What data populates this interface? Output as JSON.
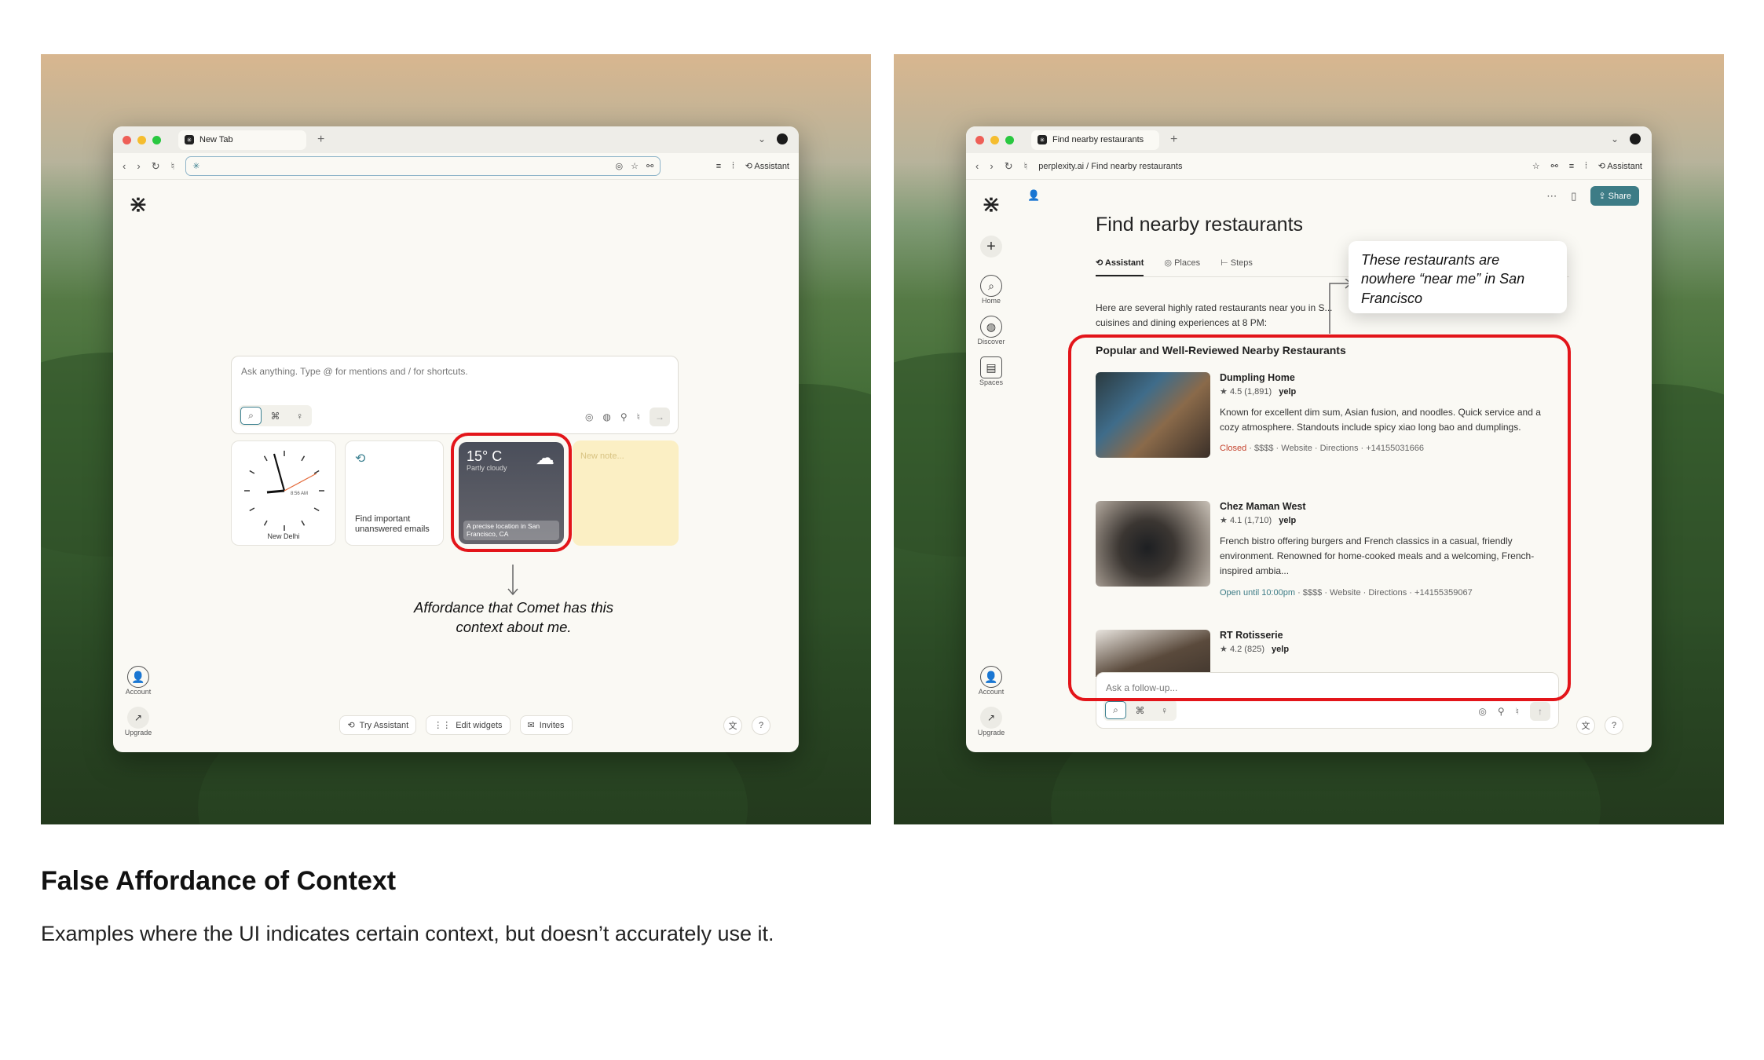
{
  "left": {
    "tab_title": "New Tab",
    "assistant_label": "Assistant",
    "ask_placeholder": "Ask anything. Type @ for mentions and / for shortcuts.",
    "clock_time": "8:56 AM",
    "clock_city": "New Delhi",
    "email_widget": "Find important unanswered emails",
    "weather_temp": "15° C",
    "weather_condition": "Partly cloudy",
    "weather_location": "A precise location in San Francisco, CA",
    "note_placeholder": "New note...",
    "account_label": "Account",
    "upgrade_label": "Upgrade",
    "chips": [
      "Try Assistant",
      "Edit widgets",
      "Invites"
    ],
    "annotation": "Affordance that Comet has this context about me."
  },
  "right": {
    "tab_title": "Find nearby restaurants",
    "url": "perplexity.ai / Find nearby restaurants",
    "assistant_label": "Assistant",
    "share_label": "Share",
    "page_title": "Find nearby restaurants",
    "tabs": [
      "Assistant",
      "Places",
      "Steps"
    ],
    "intro": "Here are several highly rated restaurants near you in S... cuisines and dining experiences at 8 PM:",
    "section_title": "Popular and Well-Reviewed Nearby Restaurants",
    "nav": [
      "Home",
      "Discover",
      "Spaces"
    ],
    "account_label": "Account",
    "upgrade_label": "Upgrade",
    "callout": "These restaurants are nowhere “near me” in San Francisco",
    "followup_placeholder": "Ask a follow-up...",
    "restaurants": [
      {
        "name": "Dumpling Home",
        "rating": "4.5",
        "reviews": "(1,891)",
        "source": "yelp",
        "desc": "Known for excellent dim sum, Asian fusion, and noodles. Quick service and a cozy atmosphere. Standouts include spicy xiao long bao and dumplings.",
        "status": "Closed",
        "meta": " · $$$$ · Website · Directions · +14155031666"
      },
      {
        "name": "Chez Maman West",
        "rating": "4.1",
        "reviews": "(1,710)",
        "source": "yelp",
        "desc": "French bistro offering burgers and French classics in a casual, friendly environment. Renowned for home-cooked meals and a welcoming, French-inspired ambia...",
        "status": "Open until 10:00pm",
        "meta": " · $$$$ · Website · Directions · +14155359067"
      },
      {
        "name": "RT Rotisserie",
        "rating": "4.2",
        "reviews": "(825)",
        "source": "yelp",
        "desc": "",
        "status": "",
        "meta": ""
      }
    ]
  },
  "caption": {
    "title": "False Affordance of Context",
    "subtitle": "Examples where the UI indicates certain context, but doesn’t accurately use it."
  },
  "colors": {
    "highlight": "#e3151a",
    "accent": "#3d7c86"
  }
}
